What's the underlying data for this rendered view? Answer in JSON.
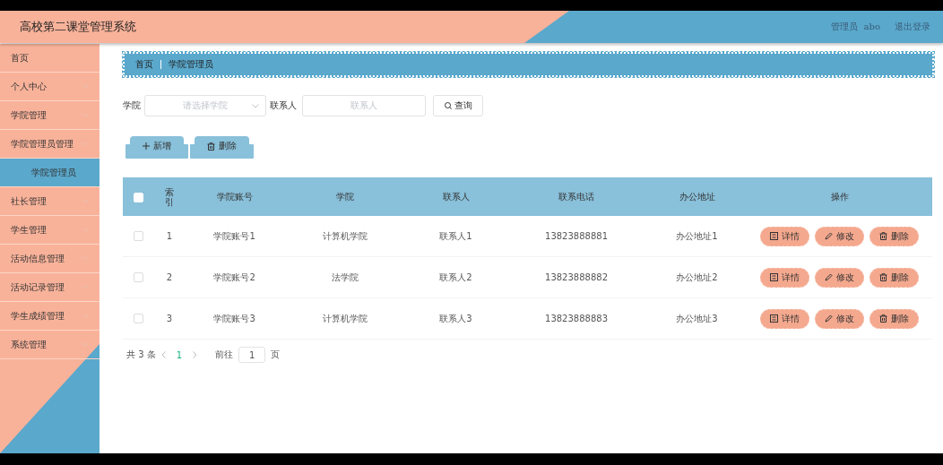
{
  "header": {
    "title": "高校第二课堂管理系统",
    "user_role": "管理员",
    "user_name": "abo",
    "logout": "退出登录"
  },
  "sidebar": {
    "items": [
      {
        "label": "首页",
        "kind": "link",
        "selected": false
      },
      {
        "label": "个人中心",
        "kind": "menu",
        "selected": false
      },
      {
        "label": "学院管理",
        "kind": "menu",
        "selected": false
      },
      {
        "label": "学院管理员管理",
        "kind": "menu",
        "selected": false
      },
      {
        "label": "学院管理员",
        "kind": "submenu",
        "selected": true
      },
      {
        "label": "社长管理",
        "kind": "menu",
        "selected": false
      },
      {
        "label": "学生管理",
        "kind": "menu",
        "selected": false
      },
      {
        "label": "活动信息管理",
        "kind": "menu",
        "selected": false
      },
      {
        "label": "活动记录管理",
        "kind": "menu",
        "selected": false
      },
      {
        "label": "学生成绩管理",
        "kind": "menu",
        "selected": false
      },
      {
        "label": "系统管理",
        "kind": "menu",
        "selected": false
      }
    ]
  },
  "breadcrumb": [
    "首页",
    "学院管理员"
  ],
  "search": {
    "college_label": "学院",
    "college_placeholder": "请选择学院",
    "contact_label": "联系人",
    "contact_placeholder": "联系人",
    "query_button": "查询"
  },
  "actions": {
    "add": "新增",
    "delete": "删除"
  },
  "table": {
    "select_all_checked": false,
    "columns": [
      "索引",
      "学院账号",
      "学院",
      "联系人",
      "联系电话",
      "办公地址",
      "操作"
    ],
    "rows": [
      {
        "checked": false,
        "cells": [
          "1",
          "学院账号1",
          "计算机学院",
          "联系人1",
          "13823888881",
          "办公地址1"
        ],
        "buttons": [
          "详情",
          "修改",
          "删除"
        ]
      },
      {
        "checked": false,
        "cells": [
          "2",
          "学院账号2",
          "法学院",
          "联系人2",
          "13823888882",
          "办公地址2"
        ],
        "buttons": [
          "详情",
          "修改",
          "删除"
        ]
      },
      {
        "checked": false,
        "cells": [
          "3",
          "学院账号3",
          "计算机学院",
          "联系人3",
          "13823888883",
          "办公地址3"
        ],
        "buttons": [
          "详情",
          "修改",
          "删除"
        ]
      }
    ]
  },
  "pagination": {
    "total_prefix": "共",
    "total": "3",
    "total_suffix": "条",
    "current_page": "1",
    "goto_label": "前往",
    "goto_value": "1",
    "goto_suffix": "页"
  }
}
